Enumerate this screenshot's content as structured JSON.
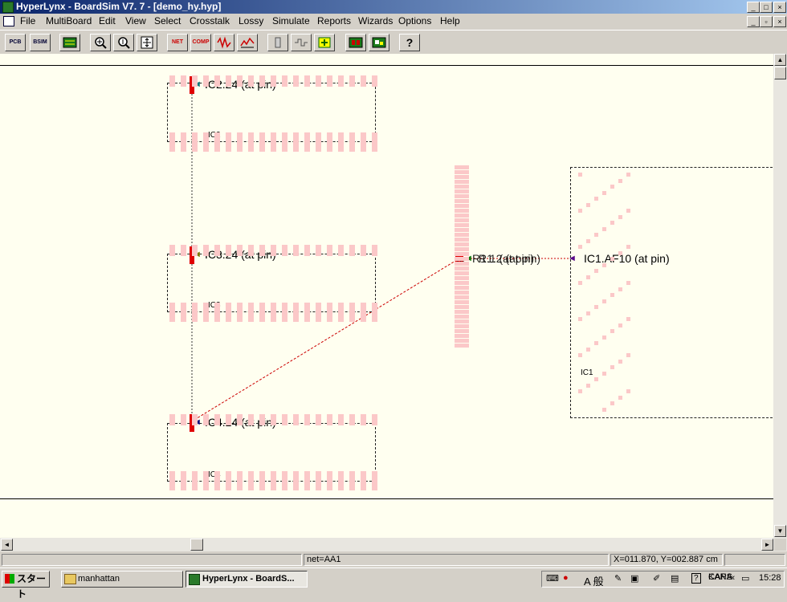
{
  "window": {
    "title": "HyperLynx - BoardSim V7. 7 - [demo_hy.hyp]"
  },
  "menu": [
    "File",
    "MultiBoard",
    "Edit",
    "View",
    "Select",
    "Crosstalk",
    "Lossy",
    "Simulate",
    "Reports",
    "Wizards",
    "Options",
    "Help"
  ],
  "toolbar": {
    "pcb": "PCB",
    "bsim": "BSIM",
    "net": "NET",
    "comp": "COMP",
    "help": "?"
  },
  "canvas": {
    "components": [
      {
        "ref": "IC2",
        "probe": "IC2.24 (at pin)"
      },
      {
        "ref": "IC3",
        "probe": "IC3.24 (at pin)"
      },
      {
        "ref": "IC4",
        "probe": "IC4.24 (at pin)"
      },
      {
        "ref": "IC1",
        "probe": "IC1.AF10 (at pin)"
      }
    ],
    "resistor_label": "R1.2 (at pin)",
    "resistor_label_overlap": "R1.1 (at pin)",
    "resistor_ref": "R1",
    "colors": {
      "background": "#fffff0",
      "net_trace": "#cc0000",
      "pin_pad": "#fbc8c8",
      "driver": "#e00000"
    }
  },
  "statusbar": {
    "net": "net=AA1",
    "coords": "X=011.870, Y=002.887 cm"
  },
  "taskbar": {
    "start": "スタート",
    "tasks": [
      "manhattan",
      "HyperLynx - BoardS..."
    ],
    "ime": "A 般",
    "caps": "CAPS",
    "kana": "KANA",
    "time": "15:28"
  }
}
